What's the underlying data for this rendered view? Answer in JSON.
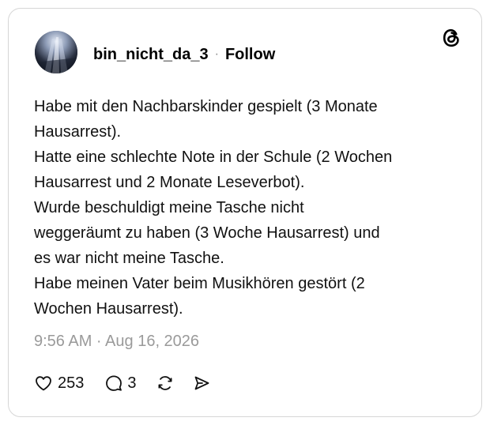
{
  "post": {
    "author": {
      "username": "bin_nicht_da_3",
      "avatar_icon": "avatar-photo"
    },
    "separator": "·",
    "follow_label": "Follow",
    "brand_icon": "threads-logo-icon",
    "body_lines": [
      "Habe mit den Nachbarskinder gespielt (3 Monate",
      "Hausarrest).",
      "Hatte eine schlechte Note in der Schule (2 Wochen",
      "Hausarrest und 2 Monate Leseverbot).",
      "Wurde beschuldigt meine Tasche nicht",
      "weggeräumt zu haben (3 Woche  Hausarrest) und",
      "es war nicht meine Tasche.",
      "Habe meinen Vater beim Musikhören gestört (2",
      "Wochen Hausarrest)."
    ],
    "timestamp": "9:56 AM · Aug 16, 2026",
    "actions": {
      "like": {
        "icon": "heart-icon",
        "count": "253"
      },
      "reply": {
        "icon": "comment-icon",
        "count": "3"
      },
      "repost": {
        "icon": "repost-icon"
      },
      "share": {
        "icon": "send-icon"
      }
    }
  },
  "colors": {
    "border": "#d6d6d6",
    "text": "#111111",
    "muted": "#9a9a9a"
  }
}
